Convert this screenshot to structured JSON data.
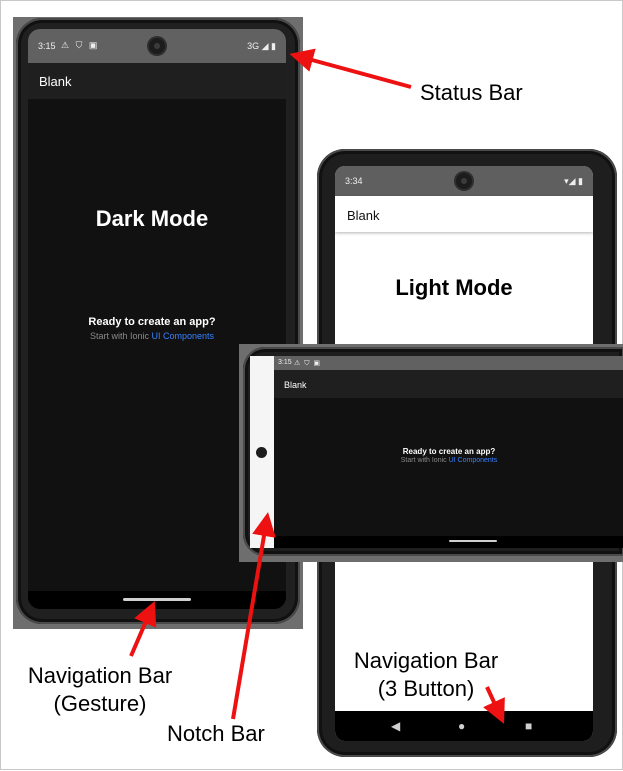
{
  "dark_phone": {
    "status_time": "3:15",
    "status_icons": "⚠ ⛉ ▣",
    "status_network": "3G ◢ ▮",
    "toolbar_title": "Blank",
    "heading": "Dark Mode",
    "ready_text": "Ready to create an app?",
    "start_text": "Start with Ionic",
    "link_text": "UI Components"
  },
  "light_phone": {
    "status_time": "3:34",
    "status_network": "▾◢ ▮",
    "toolbar_title": "Blank",
    "heading": "Light Mode",
    "nav_back": "◀",
    "nav_home": "●",
    "nav_recent": "■"
  },
  "landscape_phone": {
    "status_time": "3:15",
    "status_icons": "⚠ ⛉ ▣",
    "toolbar_title": "Blank",
    "ready_text": "Ready to create an app?",
    "start_text": "Start with Ionic",
    "link_text": "UI Components"
  },
  "annotations": {
    "status_bar": "Status Bar",
    "nav_gesture_line1": "Navigation Bar",
    "nav_gesture_line2": "(Gesture)",
    "notch_bar": "Notch Bar",
    "nav_3button_line1": "Navigation Bar",
    "nav_3button_line2": "(3 Button)"
  },
  "colors": {
    "arrow": "#ee1111",
    "link": "#3880ff",
    "dark_status_bar": "#616161",
    "dark_background": "#111111"
  }
}
